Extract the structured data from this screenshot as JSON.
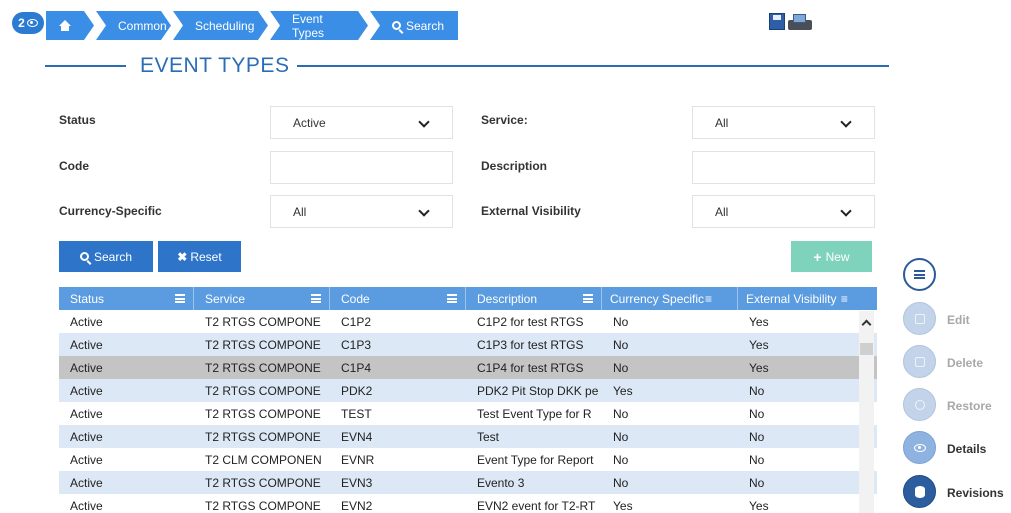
{
  "badge": {
    "count": "2"
  },
  "breadcrumb": {
    "items": [
      "Common",
      "Scheduling",
      "Event Types",
      "Search"
    ]
  },
  "page": {
    "title": "EVENT TYPES"
  },
  "filters": {
    "status": {
      "label": "Status",
      "value": "Active"
    },
    "service": {
      "label": "Service:",
      "value": "All"
    },
    "code": {
      "label": "Code",
      "value": ""
    },
    "description": {
      "label": "Description",
      "value": ""
    },
    "currency_specific": {
      "label": "Currency-Specific",
      "value": "All"
    },
    "external_visibility": {
      "label": "External Visibility",
      "value": "All"
    }
  },
  "buttons": {
    "search": "Search",
    "reset": "Reset",
    "new": "New"
  },
  "table": {
    "columns": [
      "Status",
      "Service",
      "Code",
      "Description",
      "Currency Specific",
      "External Visibility"
    ],
    "rows": [
      [
        "Active",
        "T2 RTGS COMPONE",
        "C1P2",
        "C1P2 for test RTGS",
        "No",
        "Yes"
      ],
      [
        "Active",
        "T2 RTGS COMPONE",
        "C1P3",
        "C1P3 for test RTGS",
        "No",
        "Yes"
      ],
      [
        "Active",
        "T2 RTGS COMPONE",
        "C1P4",
        "C1P4 for test RTGS",
        "No",
        "Yes"
      ],
      [
        "Active",
        "T2 RTGS COMPONE",
        "PDK2",
        "PDK2 Pit Stop DKK pe",
        "Yes",
        "No"
      ],
      [
        "Active",
        "T2 RTGS COMPONE",
        "TEST",
        "Test Event Type for R",
        "No",
        "No"
      ],
      [
        "Active",
        "T2 RTGS COMPONE",
        "EVN4",
        "Test",
        "No",
        "No"
      ],
      [
        "Active",
        "T2 CLM COMPONEN",
        "EVNR",
        "Event Type for Report",
        "No",
        "No"
      ],
      [
        "Active",
        "T2 RTGS COMPONE",
        "EVN3",
        "Evento 3",
        "No",
        "No"
      ],
      [
        "Active",
        "T2 RTGS COMPONE",
        "EVN2",
        "EVN2 event for T2-RT",
        "Yes",
        "Yes"
      ]
    ],
    "selected_row": 2
  },
  "actions": {
    "edit": "Edit",
    "delete": "Delete",
    "restore": "Restore",
    "details": "Details",
    "revisions": "Revisions"
  },
  "colors": {
    "primary": "#2e75c9",
    "header": "#5b9be0",
    "row_alt": "#dce8f6",
    "selected": "#c4c4c4",
    "new_button": "#7fd3bd"
  }
}
